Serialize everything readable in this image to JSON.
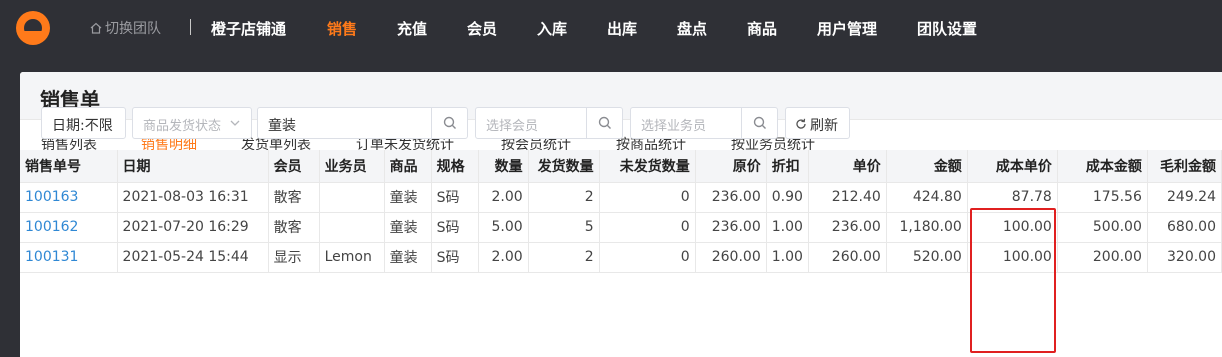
{
  "topbar": {
    "switch_team": "切换团队",
    "nav": [
      {
        "label": "橙子店铺通",
        "active": false
      },
      {
        "label": "销售",
        "active": true
      },
      {
        "label": "充值",
        "active": false
      },
      {
        "label": "会员",
        "active": false
      },
      {
        "label": "入库",
        "active": false
      },
      {
        "label": "出库",
        "active": false
      },
      {
        "label": "盘点",
        "active": false
      },
      {
        "label": "商品",
        "active": false
      },
      {
        "label": "用户管理",
        "active": false
      },
      {
        "label": "团队设置",
        "active": false
      }
    ]
  },
  "page": {
    "title": "销售单",
    "tabs": [
      "销售列表",
      "销售明细",
      "发货单列表",
      "订单未发货统计",
      "按会员统计",
      "按商品统计",
      "按业务员统计"
    ],
    "active_tab": "销售明细"
  },
  "filters": {
    "date": "日期:不限",
    "ship_status_placeholder": "商品发货状态",
    "keyword": "童装",
    "member_placeholder": "选择会员",
    "staff_placeholder": "选择业务员",
    "refresh": "刷新"
  },
  "table": {
    "headers": [
      "销售单号",
      "日期",
      "会员",
      "业务员",
      "商品",
      "规格",
      "数量",
      "发货数量",
      "未发货数量",
      "原价",
      "折扣",
      "单价",
      "金额",
      "成本单价",
      "成本金额",
      "毛利金额"
    ],
    "rows": [
      [
        "100163",
        "2021-08-03 16:31",
        "散客",
        "",
        "童装",
        "S码",
        "2.00",
        "2",
        "0",
        "236.00",
        "0.90",
        "212.40",
        "424.80",
        "87.78",
        "175.56",
        "249.24"
      ],
      [
        "100162",
        "2021-07-20 16:29",
        "散客",
        "",
        "童装",
        "S码",
        "5.00",
        "5",
        "0",
        "236.00",
        "1.00",
        "236.00",
        "1,180.00",
        "100.00",
        "500.00",
        "680.00"
      ],
      [
        "100131",
        "2021-05-24 15:44",
        "显示",
        "Lemon",
        "童装",
        "S码",
        "2.00",
        "2",
        "0",
        "260.00",
        "1.00",
        "260.00",
        "520.00",
        "100.00",
        "200.00",
        "320.00"
      ]
    ]
  },
  "colors": {
    "accent": "#ff7a1a",
    "link": "#2f88d4",
    "highlight": "#e02020",
    "topbar_bg": "#2f3036"
  }
}
